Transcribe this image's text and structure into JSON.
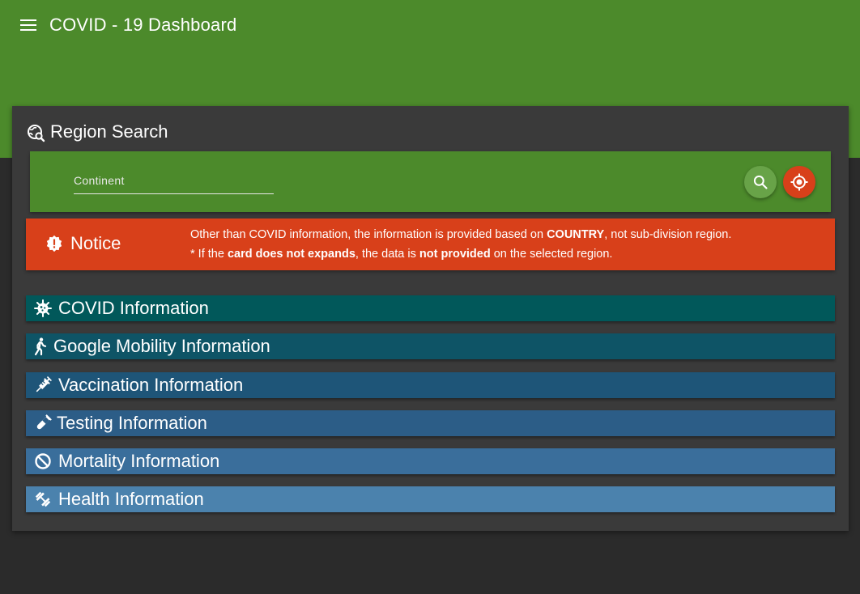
{
  "header": {
    "title": "COVID - 19 Dashboard",
    "menu_icon": "menu-icon",
    "background": "#4c8a2b"
  },
  "region_search": {
    "title": "Region Search",
    "title_icon": "travel-explore-icon",
    "field_placeholder": "Continent",
    "search_icon": "search-icon",
    "locate_icon": "my-location-icon"
  },
  "notice": {
    "title": "Notice",
    "icon": "new-releases-icon",
    "line1_a": "Other than COVID information, the information is provided based on ",
    "line1_b": "COUNTRY",
    "line1_c": ", not sub-division region.",
    "line2_a": "* If the ",
    "line2_b": "card does not expands",
    "line2_c": ", the data is ",
    "line2_d": "not provided",
    "line2_e": " on the selected region.",
    "background": "#d8401a"
  },
  "sections": [
    {
      "label": "COVID Information",
      "icon": "coronavirus-icon",
      "color": "#01585a"
    },
    {
      "label": "Google Mobility Information",
      "icon": "walk-icon",
      "color": "#0e5466"
    },
    {
      "label": "Vaccination Information",
      "icon": "vaccine-icon",
      "color": "#1e5578"
    },
    {
      "label": "Testing Information",
      "icon": "test-tube-icon",
      "color": "#2c5d87"
    },
    {
      "label": "Mortality Information",
      "icon": "block-icon",
      "color": "#3a6e9b"
    },
    {
      "label": "Health Information",
      "icon": "fitness-icon",
      "color": "#4b82ad"
    }
  ]
}
